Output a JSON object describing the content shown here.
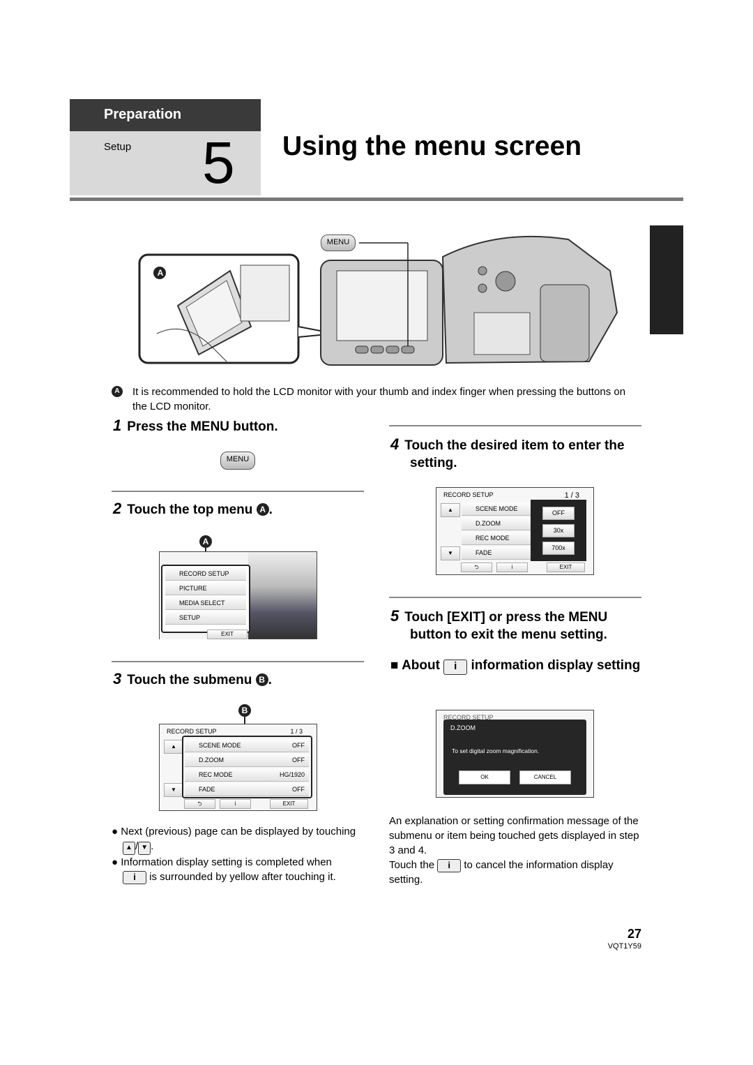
{
  "header": {
    "section": "Preparation",
    "subsection": "Setup",
    "number": "5",
    "title": "Using the menu screen"
  },
  "illustration": {
    "label_a": "A",
    "menu_button": "MENU"
  },
  "note_a": {
    "marker": "A",
    "text": "It is recommended to hold the LCD monitor with your thumb and index finger when pressing the buttons on the LCD monitor."
  },
  "steps": [
    {
      "num": "1",
      "text": "Press the MENU button.",
      "button": "MENU"
    },
    {
      "num": "2",
      "text": "Touch the top menu ",
      "marker": "A"
    },
    {
      "num": "3",
      "text": "Touch the submenu ",
      "marker": "B"
    },
    {
      "num": "4",
      "text": "Touch the desired item to enter the setting."
    },
    {
      "num": "5",
      "text": "Touch [EXIT] or press the MENU button to exit the menu setting."
    }
  ],
  "top_menu": {
    "items": [
      "RECORD SETUP",
      "PICTURE",
      "MEDIA SELECT",
      "SETUP"
    ],
    "exit": "EXIT"
  },
  "submenu": {
    "title": "RECORD SETUP",
    "page": "1 / 3",
    "items": [
      {
        "label": "SCENE MODE",
        "value": "OFF"
      },
      {
        "label": "D.ZOOM",
        "value": "OFF"
      },
      {
        "label": "REC MODE",
        "value": "HG/1920"
      },
      {
        "label": "FADE",
        "value": "OFF"
      }
    ],
    "exit": "EXIT"
  },
  "options": [
    "OFF",
    "30x",
    "700x"
  ],
  "info_dialog": {
    "item": "D.ZOOM",
    "message": "To set digital zoom magnification.",
    "ok": "OK",
    "cancel": "CANCEL"
  },
  "bullets": {
    "b1a": "Next (previous) page can be displayed by touching",
    "b1b": ".",
    "b2a": "Information display setting is completed when",
    "b2b": "is surrounded by yellow after touching it."
  },
  "about": {
    "prefix": "About",
    "suffix": "information display setting"
  },
  "explain": {
    "p1": "An explanation or setting confirmation message of the submenu or item being touched gets displayed in step 3 and 4.",
    "p2a": "Touch the",
    "p2b": "to cancel the information display setting."
  },
  "footer": {
    "page": "27",
    "code": "VQT1Y59"
  }
}
